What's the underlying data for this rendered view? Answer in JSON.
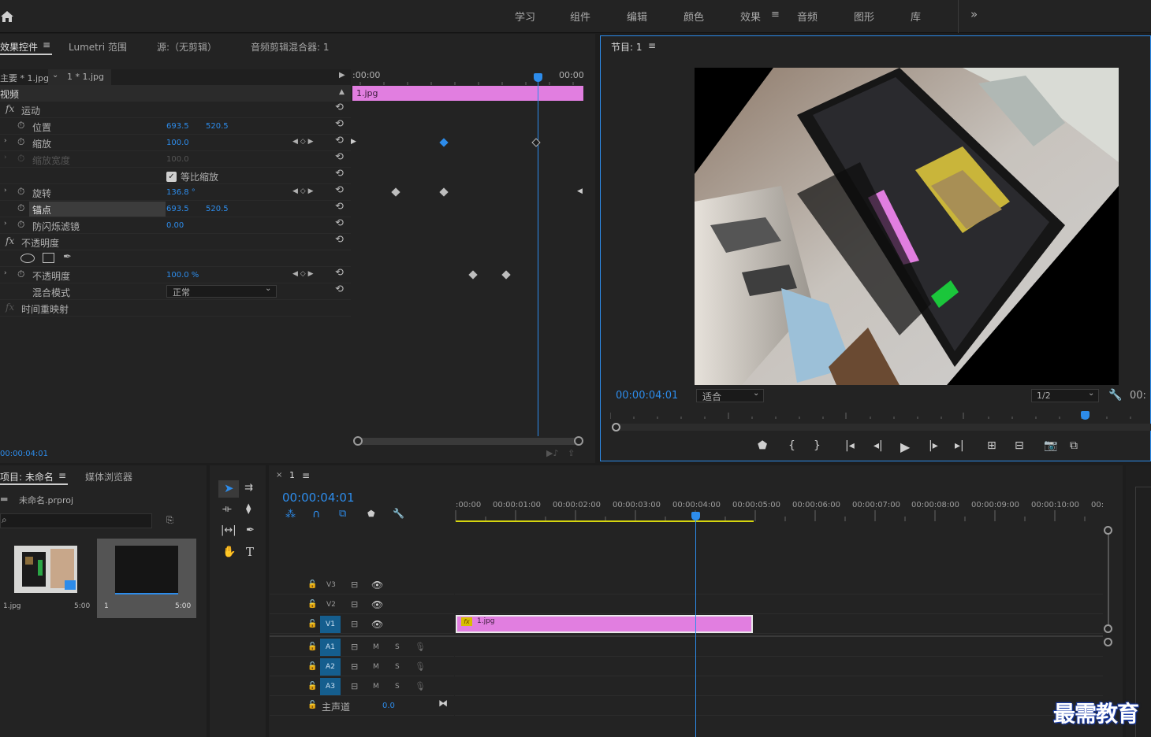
{
  "topbar": {
    "items": [
      "学习",
      "组件",
      "编辑",
      "颜色",
      "效果",
      "音频",
      "图形",
      "库"
    ],
    "active": "效果",
    "more": "»"
  },
  "effects_panel": {
    "tabs": [
      "效果控件",
      "Lumetri 范围",
      "源:（无剪辑）",
      "音频剪辑混合器: 1"
    ],
    "master": "主要 * 1.jpg",
    "clip": "1 * 1.jpg",
    "section": "视频",
    "ruler_start": ":00:00",
    "ruler_end": "00:00",
    "clip_bar": "1.jpg",
    "rows": [
      {
        "name": "运动",
        "fx": true
      },
      {
        "name": "位置",
        "v1": "693.5",
        "v2": "520.5"
      },
      {
        "name": "缩放",
        "v1": "100.0"
      },
      {
        "name": "缩放宽度",
        "v1": "100.0",
        "dim": true
      },
      {
        "name": "等比缩放",
        "checkbox": true
      },
      {
        "name": "旋转",
        "v1": "136.8 °"
      },
      {
        "name": "锚点",
        "v1": "693.5",
        "v2": "520.5"
      },
      {
        "name": "防闪烁滤镜",
        "v1": "0.00"
      },
      {
        "name": "不透明度",
        "fx": true
      },
      {
        "name": "shapes"
      },
      {
        "name": "不透明度",
        "v1": "100.0 %"
      },
      {
        "name": "混合模式",
        "select": "正常"
      },
      {
        "name": "时间重映射",
        "fx": true
      }
    ],
    "timecode": "00:00:04:01"
  },
  "program": {
    "title": "节目: 1",
    "timecode": "00:00:04:01",
    "fit": "适合",
    "quality": "1/2",
    "tc_right": "00:"
  },
  "project": {
    "tabs": [
      "项目: 未命名",
      "媒体浏览器"
    ],
    "file": "未命名.prproj",
    "items": [
      {
        "name": "1.jpg",
        "dur": "5:00"
      },
      {
        "name": "1",
        "dur": "5:00"
      }
    ]
  },
  "timeline": {
    "tab": "1",
    "timecode": "00:00:04:01",
    "ruler": [
      ":00:00",
      "00:00:01:00",
      "00:00:02:00",
      "00:00:03:00",
      "00:00:04:00",
      "00:00:05:00",
      "00:00:06:00",
      "00:00:07:00",
      "00:00:08:00",
      "00:00:09:00",
      "00:00:10:00",
      "00:"
    ],
    "video_tracks": [
      "V3",
      "V2",
      "V1"
    ],
    "audio_tracks": [
      "A1",
      "A2",
      "A3"
    ],
    "mute": "M",
    "solo": "S",
    "master": "主声道",
    "master_val": "0.0",
    "clip": "1.jpg"
  },
  "watermark": "最需教育",
  "colors": {
    "accent": "#2d8ceb",
    "clip": "#e17ee0",
    "work_area": "#d6d60f"
  }
}
